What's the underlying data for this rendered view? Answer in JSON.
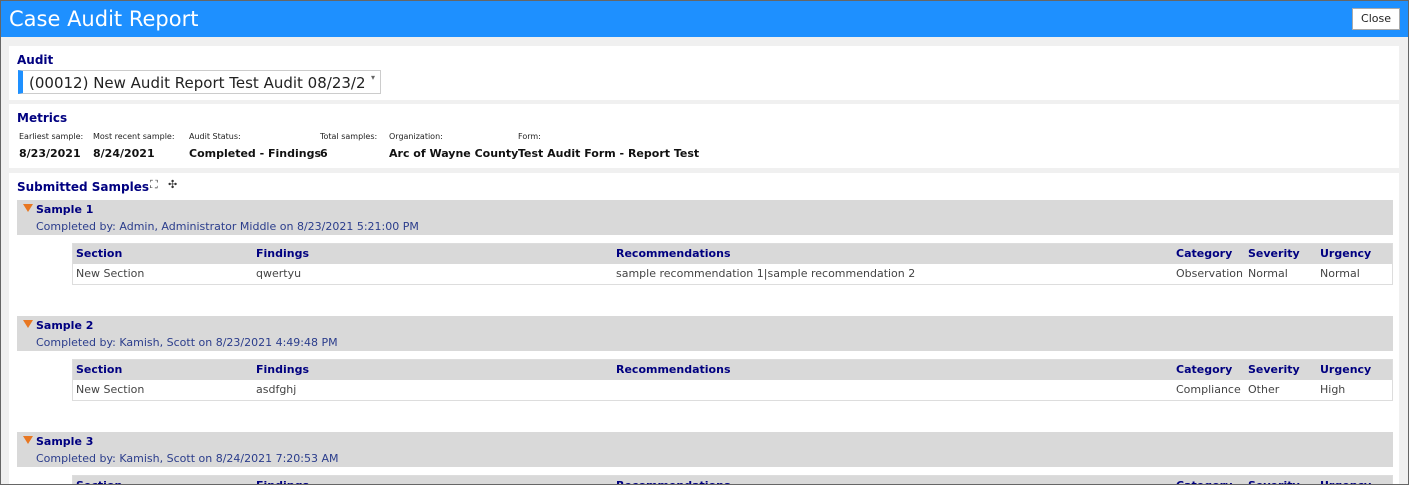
{
  "window": {
    "title": "Case Audit Report",
    "close_label": "Close"
  },
  "audit": {
    "section_title": "Audit",
    "selected": "(00012) New Audit Report Test Audit 08/23/2"
  },
  "metrics": {
    "section_title": "Metrics",
    "items": [
      {
        "label": "Earliest sample:",
        "value": "8/23/2021"
      },
      {
        "label": "Most recent sample:",
        "value": "8/24/2021"
      },
      {
        "label": "Audit Status:",
        "value": "Completed - Findings"
      },
      {
        "label": "Total samples:",
        "value": "6"
      },
      {
        "label": "Organization:",
        "value": "Arc of Wayne County"
      },
      {
        "label": "Form:",
        "value": "Test Audit Form - Report Test"
      }
    ]
  },
  "samples": {
    "section_title": "Submitted Samples",
    "expand_icon": "expand-all-icon",
    "collapse_icon": "collapse-all-icon",
    "columns": [
      "Section",
      "Findings",
      "Recommendations",
      "Category",
      "Severity",
      "Urgency"
    ],
    "items": [
      {
        "title": "Sample 1",
        "completed_by": "Completed by: Admin, Administrator Middle on 8/23/2021 5:21:00 PM",
        "rows": [
          [
            "New Section",
            "qwertyu",
            "sample recommendation 1|sample recommendation 2",
            "Observation",
            "Normal",
            "Normal"
          ]
        ]
      },
      {
        "title": "Sample 2",
        "completed_by": "Completed by: Kamish, Scott on 8/23/2021 4:49:48 PM",
        "rows": [
          [
            "New Section",
            "asdfghj",
            "",
            "Compliance",
            "Other",
            "High"
          ]
        ]
      },
      {
        "title": "Sample 3",
        "completed_by": "Completed by: Kamish, Scott on 8/24/2021 7:20:53 AM",
        "rows": []
      }
    ]
  },
  "colors": {
    "title_bar": "#1e90ff",
    "heading": "#000080",
    "toggle": "#e87722",
    "band": "#d9d9d9"
  }
}
